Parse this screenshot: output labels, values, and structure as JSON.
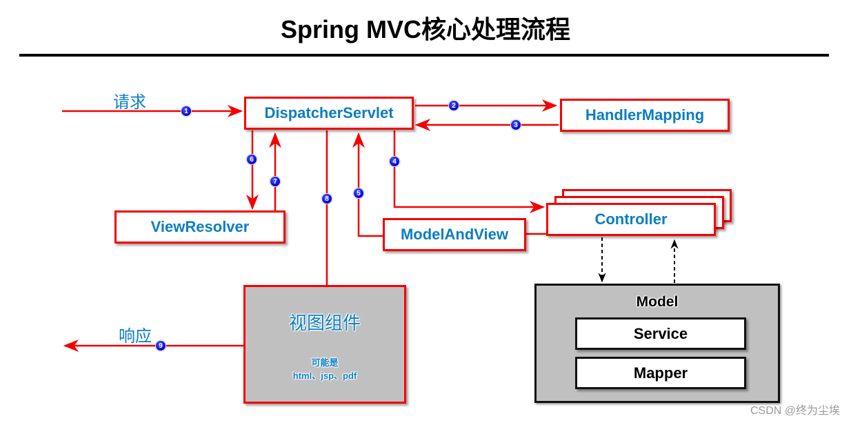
{
  "title": "Spring MVC核心处理流程",
  "labels": {
    "request": "请求",
    "response": "响应"
  },
  "components": {
    "dispatcher_servlet": "DispatcherServlet",
    "handler_mapping": "HandlerMapping",
    "view_resolver": "ViewResolver",
    "model_and_view": "ModelAndView",
    "controller": "Controller",
    "view_component": {
      "title": "视图组件",
      "subtitle": "可能是",
      "formats": "html、jsp、pdf"
    },
    "model": {
      "title": "Model",
      "layers": [
        "Service",
        "Mapper"
      ]
    }
  },
  "steps": [
    "1",
    "2",
    "3",
    "4",
    "5",
    "6",
    "7",
    "8",
    "9"
  ],
  "colors": {
    "arrow": "#f50000",
    "component_text": "#0a7ec2",
    "badge": "#0000d0",
    "view_fill": "#c0c0c0"
  },
  "watermark": "CSDN @终为尘埃"
}
